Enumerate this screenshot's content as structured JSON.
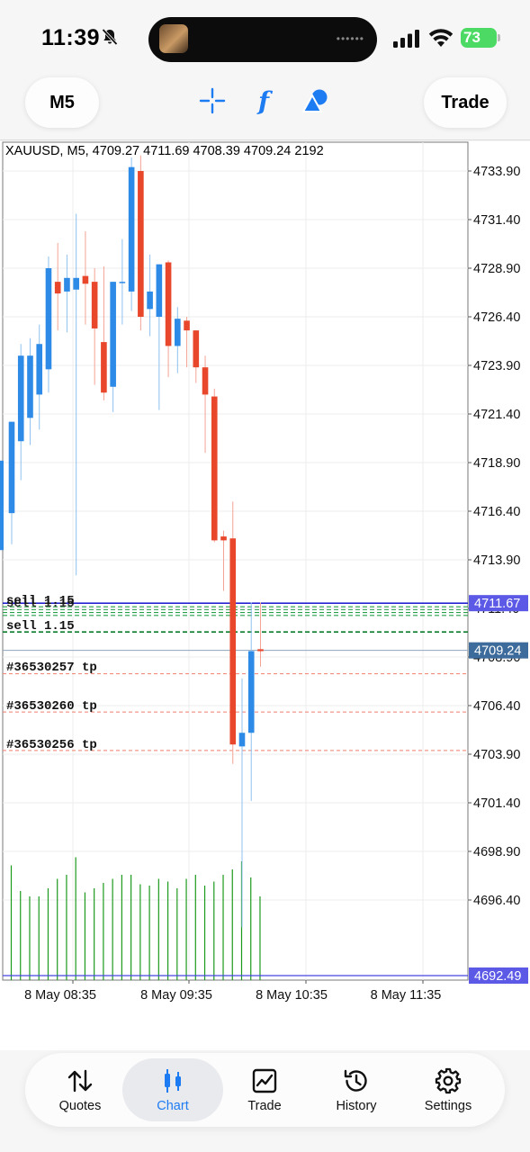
{
  "status_bar": {
    "time": "11:39",
    "battery": "73"
  },
  "toolbar": {
    "timeframe": "M5",
    "trade_label": "Trade"
  },
  "chart": {
    "header": "XAUUSD, M5, 4709.27 4711.69 4708.39 4709.24 2192",
    "price_labels": [
      "4733.90",
      "4731.40",
      "4728.90",
      "4726.40",
      "4723.90",
      "4721.40",
      "4718.90",
      "4716.40",
      "4713.90",
      "4711.40",
      "4708.90",
      "4706.40",
      "4703.90",
      "4701.40",
      "4698.90",
      "4696.40"
    ],
    "time_labels": [
      "8 May 08:35",
      "8 May 09:35",
      "8 May 10:35",
      "8 May 11:35"
    ],
    "markers": {
      "bid_line": "4711.67",
      "current_price": "4709.24",
      "volume_line": "4692.49"
    },
    "orders": {
      "sell_stack_label": "sell 1.15",
      "sell_label": "sell 1.15",
      "tp_1": "#36530257 tp",
      "tp_2": "#36530260 tp",
      "tp_3": "#36530256 tp"
    },
    "colors": {
      "bull": "#2d8ae6",
      "bear": "#e8472b",
      "volume": "#1c9a1c",
      "bid": "#0000c8",
      "marker_bg": "#5b59e6",
      "price_bg": "#3d6c9c",
      "tp_line": "#f07f6d",
      "sell_line": "#0b7d2b"
    }
  },
  "chart_data": {
    "type": "candlestick",
    "title": "XAUUSD, M5",
    "symbol": "XAUUSD",
    "timeframe": "M5",
    "ylim": [
      4693.6,
      4735.2
    ],
    "y_ticks": [
      4733.9,
      4731.4,
      4728.9,
      4726.4,
      4723.9,
      4721.4,
      4718.9,
      4716.4,
      4713.9,
      4711.4,
      4708.9,
      4706.4,
      4703.9,
      4701.4,
      4698.9,
      4696.4
    ],
    "x_tick_labels": [
      "8 May 08:35",
      "8 May 09:35",
      "8 May 10:35",
      "8 May 11:35"
    ],
    "candles": [
      {
        "o": 4716.3,
        "h": 4720.0,
        "l": 4714.7,
        "c": 4721.0
      },
      {
        "o": 4720.0,
        "h": 4725.0,
        "l": 4718.0,
        "c": 4724.4
      },
      {
        "o": 4721.2,
        "h": 4725.3,
        "l": 4719.8,
        "c": 4724.4
      },
      {
        "o": 4722.4,
        "h": 4726.0,
        "l": 4720.6,
        "c": 4725.0
      },
      {
        "o": 4723.7,
        "h": 4729.5,
        "l": 4722.5,
        "c": 4728.9
      },
      {
        "o": 4728.2,
        "h": 4730.2,
        "l": 4725.7,
        "c": 4727.6
      },
      {
        "o": 4727.7,
        "h": 4729.6,
        "l": 4725.6,
        "c": 4728.4
      },
      {
        "o": 4727.8,
        "h": 4731.7,
        "l": 4713.1,
        "c": 4728.4
      },
      {
        "o": 4728.5,
        "h": 4730.8,
        "l": 4726.0,
        "c": 4728.1
      },
      {
        "o": 4728.2,
        "h": 4728.9,
        "l": 4722.9,
        "c": 4725.8
      },
      {
        "o": 4725.1,
        "h": 4729.0,
        "l": 4722.1,
        "c": 4722.5
      },
      {
        "o": 4722.8,
        "h": 4728.1,
        "l": 4721.5,
        "c": 4728.2
      },
      {
        "o": 4728.2,
        "h": 4730.4,
        "l": 4726.0,
        "c": 4728.2
      },
      {
        "o": 4727.7,
        "h": 4734.6,
        "l": 4726.7,
        "c": 4734.1
      },
      {
        "o": 4733.9,
        "h": 4734.7,
        "l": 4725.7,
        "c": 4726.4
      },
      {
        "o": 4726.8,
        "h": 4729.6,
        "l": 4725.4,
        "c": 4727.7
      },
      {
        "o": 4726.4,
        "h": 4729.1,
        "l": 4721.6,
        "c": 4729.1
      },
      {
        "o": 4729.2,
        "h": 4729.3,
        "l": 4723.3,
        "c": 4724.9
      },
      {
        "o": 4724.9,
        "h": 4726.9,
        "l": 4723.5,
        "c": 4726.3
      },
      {
        "o": 4726.2,
        "h": 4726.4,
        "l": 4723.8,
        "c": 4725.7
      },
      {
        "o": 4725.7,
        "h": 4725.1,
        "l": 4723.0,
        "c": 4723.8
      },
      {
        "o": 4723.8,
        "h": 4724.4,
        "l": 4719.4,
        "c": 4722.4
      },
      {
        "o": 4722.3,
        "h": 4722.7,
        "l": 4714.8,
        "c": 4714.9
      },
      {
        "o": 4715.1,
        "h": 4715.4,
        "l": 4712.3,
        "c": 4714.9
      },
      {
        "o": 4715.0,
        "h": 4716.9,
        "l": 4703.4,
        "c": 4704.4
      },
      {
        "o": 4704.3,
        "h": 4707.8,
        "l": 4695.0,
        "c": 4705.0
      },
      {
        "o": 4705.0,
        "h": 4711.7,
        "l": 4701.5,
        "c": 4709.2
      },
      {
        "o": 4709.3,
        "h": 4711.7,
        "l": 4708.4,
        "c": 4709.2
      }
    ],
    "volume": [
      0.85,
      0.66,
      0.62,
      0.62,
      0.68,
      0.75,
      0.78,
      0.91,
      0.65,
      0.68,
      0.72,
      0.75,
      0.78,
      0.78,
      0.71,
      0.7,
      0.75,
      0.73,
      0.68,
      0.75,
      0.78,
      0.7,
      0.73,
      0.78,
      0.82,
      0.88,
      0.76,
      0.62
    ],
    "horizontal_lines": [
      {
        "label": "bid",
        "value": 4711.67
      },
      {
        "label": "current price",
        "value": 4709.24
      },
      {
        "label": "volume level",
        "value": 4692.49
      }
    ],
    "grid": true
  }
}
